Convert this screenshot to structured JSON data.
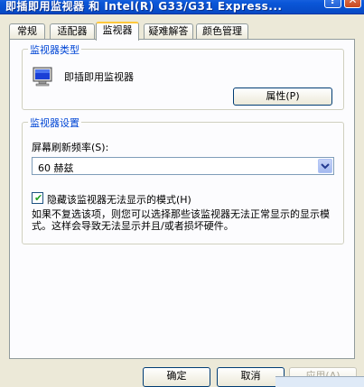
{
  "window": {
    "title": "即插即用监视器 和 Intel(R) G33/G31 Express...",
    "help_btn": "?",
    "close_btn": "✕"
  },
  "tabs": [
    "常规",
    "适配器",
    "监视器",
    "疑难解答",
    "颜色管理"
  ],
  "monitor_type": {
    "group_title": "监视器类型",
    "name": "即插即用监视器",
    "properties_btn": "属性(P)",
    "icon": "monitor-icon"
  },
  "monitor_settings": {
    "group_title": "监视器设置",
    "refresh_label": "屏幕刷新频率(S):",
    "refresh_value": "60 赫兹",
    "hide_modes_label": "隐藏该监视器无法显示的模式(H)",
    "hide_modes_checked": true,
    "description": "如果不复选该项，则您可以选择那些该监视器无法正常显示的显示模式。这样会导致无法显示并且/或者损坏硬件。"
  },
  "buttons": {
    "ok": "确定",
    "cancel": "取消",
    "apply": "应用(A)"
  }
}
